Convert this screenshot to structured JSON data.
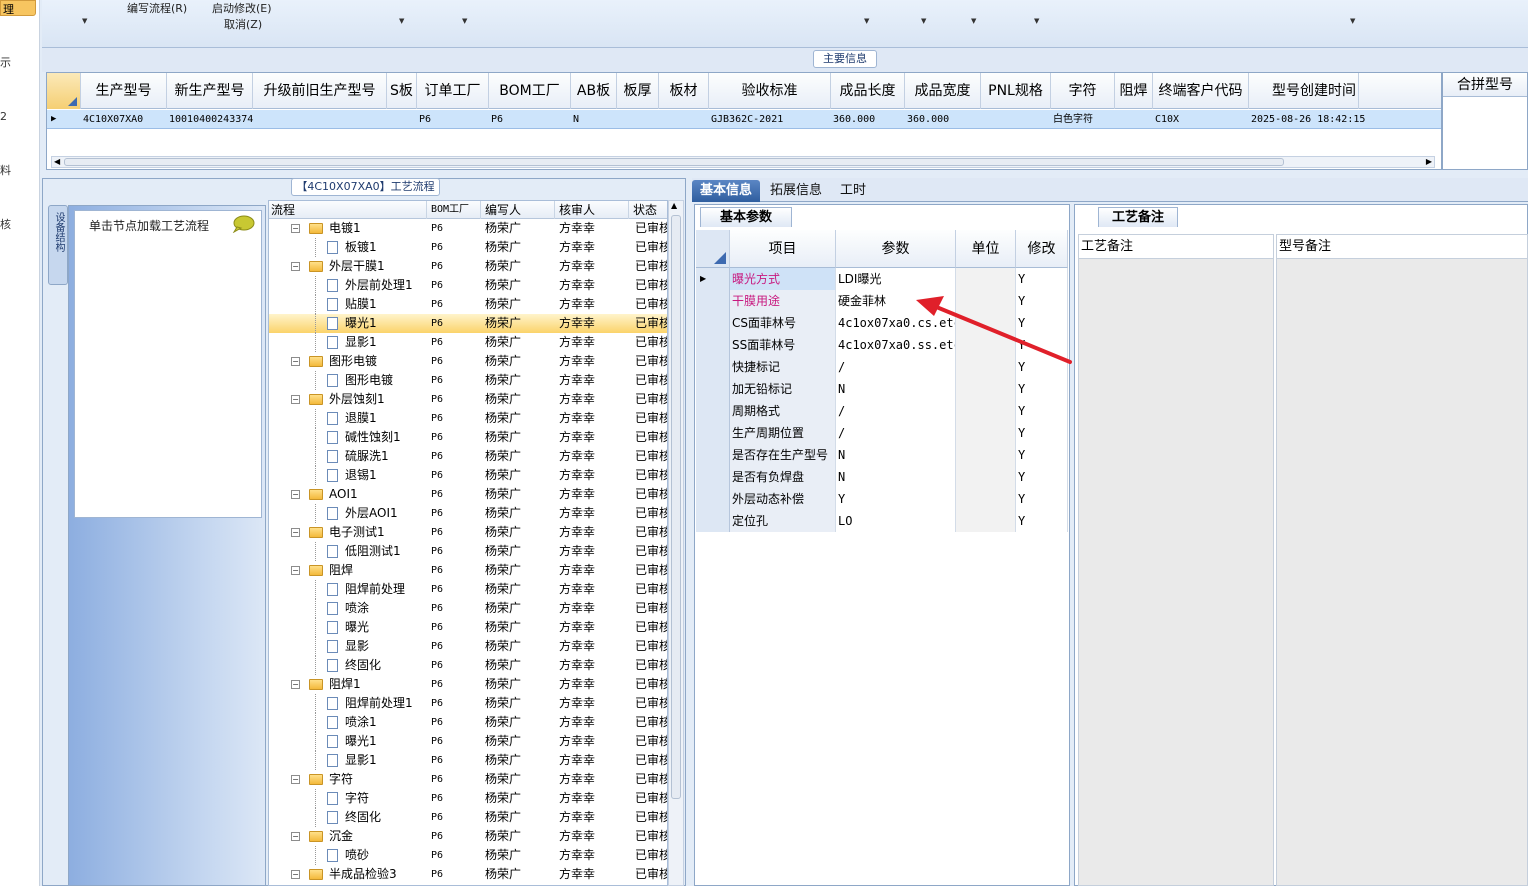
{
  "left_strip": {
    "items": [
      "理",
      "示",
      "2",
      "料",
      "核"
    ]
  },
  "ribbon": {
    "write_flow": "编写流程(R)",
    "start_edit": "启动修改(E)",
    "cancel": "取消(Z)"
  },
  "main_info": {
    "caption": "主要信息",
    "columns": [
      "生产型号",
      "新生产型号",
      "升级前旧生产型号",
      "S板",
      "订单工厂",
      "BOM工厂",
      "AB板",
      "板厚",
      "板材",
      "验收标准",
      "成品长度",
      "成品宽度",
      "PNL规格",
      "字符",
      "阻焊",
      "终端客户代码",
      "型号创建时间"
    ],
    "row": [
      "4C10X07XA0",
      "10010400243374",
      "",
      "",
      "P6",
      "P6",
      "N",
      "",
      "",
      "GJB362C-2021",
      "360.000",
      "360.000",
      "",
      "白色字符",
      "",
      "C10X",
      "2025-08-26 18:42:15"
    ],
    "merge_header": "合拼型号"
  },
  "process": {
    "caption": "【4C10X07XA0】工艺流程",
    "side_tab": "设备结构",
    "load_hint": "单击节点加载工艺流程",
    "columns": [
      "流程",
      "BOM工厂",
      "编写人",
      "核审人",
      "状态"
    ],
    "rows": [
      {
        "name": "电镀1",
        "level": 0,
        "bom": "P6",
        "writer": "杨荣广",
        "reviewer": "方幸幸",
        "status": "已审核"
      },
      {
        "name": "板镀1",
        "level": 1,
        "bom": "P6",
        "writer": "杨荣广",
        "reviewer": "方幸幸",
        "status": "已审核"
      },
      {
        "name": "外层干膜1",
        "level": 0,
        "bom": "P6",
        "writer": "杨荣广",
        "reviewer": "方幸幸",
        "status": "已审核"
      },
      {
        "name": "外层前处理1",
        "level": 1,
        "bom": "P6",
        "writer": "杨荣广",
        "reviewer": "方幸幸",
        "status": "已审核"
      },
      {
        "name": "贴膜1",
        "level": 1,
        "bom": "P6",
        "writer": "杨荣广",
        "reviewer": "方幸幸",
        "status": "已审核"
      },
      {
        "name": "曝光1",
        "level": 1,
        "bom": "P6",
        "writer": "杨荣广",
        "reviewer": "方幸幸",
        "status": "已审核",
        "selected": true
      },
      {
        "name": "显影1",
        "level": 1,
        "bom": "P6",
        "writer": "杨荣广",
        "reviewer": "方幸幸",
        "status": "已审核"
      },
      {
        "name": "图形电镀",
        "level": 0,
        "bom": "P6",
        "writer": "杨荣广",
        "reviewer": "方幸幸",
        "status": "已审核"
      },
      {
        "name": "图形电镀",
        "level": 1,
        "bom": "P6",
        "writer": "杨荣广",
        "reviewer": "方幸幸",
        "status": "已审核"
      },
      {
        "name": "外层蚀刻1",
        "level": 0,
        "bom": "P6",
        "writer": "杨荣广",
        "reviewer": "方幸幸",
        "status": "已审核"
      },
      {
        "name": "退膜1",
        "level": 1,
        "bom": "P6",
        "writer": "杨荣广",
        "reviewer": "方幸幸",
        "status": "已审核"
      },
      {
        "name": "碱性蚀刻1",
        "level": 1,
        "bom": "P6",
        "writer": "杨荣广",
        "reviewer": "方幸幸",
        "status": "已审核"
      },
      {
        "name": "硫脲洗1",
        "level": 1,
        "bom": "P6",
        "writer": "杨荣广",
        "reviewer": "方幸幸",
        "status": "已审核"
      },
      {
        "name": "退锡1",
        "level": 1,
        "bom": "P6",
        "writer": "杨荣广",
        "reviewer": "方幸幸",
        "status": "已审核"
      },
      {
        "name": "AOI1",
        "level": 0,
        "bom": "P6",
        "writer": "杨荣广",
        "reviewer": "方幸幸",
        "status": "已审核"
      },
      {
        "name": "外层AOI1",
        "level": 1,
        "bom": "P6",
        "writer": "杨荣广",
        "reviewer": "方幸幸",
        "status": "已审核"
      },
      {
        "name": "电子测试1",
        "level": 0,
        "bom": "P6",
        "writer": "杨荣广",
        "reviewer": "方幸幸",
        "status": "已审核"
      },
      {
        "name": "低阻测试1",
        "level": 1,
        "bom": "P6",
        "writer": "杨荣广",
        "reviewer": "方幸幸",
        "status": "已审核"
      },
      {
        "name": "阻焊",
        "level": 0,
        "bom": "P6",
        "writer": "杨荣广",
        "reviewer": "方幸幸",
        "status": "已审核"
      },
      {
        "name": "阻焊前处理",
        "level": 1,
        "bom": "P6",
        "writer": "杨荣广",
        "reviewer": "方幸幸",
        "status": "已审核"
      },
      {
        "name": "喷涂",
        "level": 1,
        "bom": "P6",
        "writer": "杨荣广",
        "reviewer": "方幸幸",
        "status": "已审核"
      },
      {
        "name": "曝光",
        "level": 1,
        "bom": "P6",
        "writer": "杨荣广",
        "reviewer": "方幸幸",
        "status": "已审核"
      },
      {
        "name": "显影",
        "level": 1,
        "bom": "P6",
        "writer": "杨荣广",
        "reviewer": "方幸幸",
        "status": "已审核"
      },
      {
        "name": "终固化",
        "level": 1,
        "bom": "P6",
        "writer": "杨荣广",
        "reviewer": "方幸幸",
        "status": "已审核"
      },
      {
        "name": "阻焊1",
        "level": 0,
        "bom": "P6",
        "writer": "杨荣广",
        "reviewer": "方幸幸",
        "status": "已审核"
      },
      {
        "name": "阻焊前处理1",
        "level": 1,
        "bom": "P6",
        "writer": "杨荣广",
        "reviewer": "方幸幸",
        "status": "已审核"
      },
      {
        "name": "喷涂1",
        "level": 1,
        "bom": "P6",
        "writer": "杨荣广",
        "reviewer": "方幸幸",
        "status": "已审核"
      },
      {
        "name": "曝光1",
        "level": 1,
        "bom": "P6",
        "writer": "杨荣广",
        "reviewer": "方幸幸",
        "status": "已审核"
      },
      {
        "name": "显影1",
        "level": 1,
        "bom": "P6",
        "writer": "杨荣广",
        "reviewer": "方幸幸",
        "status": "已审核"
      },
      {
        "name": "字符",
        "level": 0,
        "bom": "P6",
        "writer": "杨荣广",
        "reviewer": "方幸幸",
        "status": "已审核"
      },
      {
        "name": "字符",
        "level": 1,
        "bom": "P6",
        "writer": "杨荣广",
        "reviewer": "方幸幸",
        "status": "已审核"
      },
      {
        "name": "终固化",
        "level": 1,
        "bom": "P6",
        "writer": "杨荣广",
        "reviewer": "方幸幸",
        "status": "已审核"
      },
      {
        "name": "沉金",
        "level": 0,
        "bom": "P6",
        "writer": "杨荣广",
        "reviewer": "方幸幸",
        "status": "已审核"
      },
      {
        "name": "喷砂",
        "level": 1,
        "bom": "P6",
        "writer": "杨荣广",
        "reviewer": "方幸幸",
        "status": "已审核"
      },
      {
        "name": "半成品检验3",
        "level": 0,
        "bom": "P6",
        "writer": "杨荣广",
        "reviewer": "方幸幸",
        "status": "已审核"
      }
    ]
  },
  "right_tabs": [
    "基本信息",
    "拓展信息",
    "工时"
  ],
  "basic_params": {
    "caption": "基本参数",
    "columns": [
      "项目",
      "参数",
      "单位",
      "修改"
    ],
    "rows": [
      {
        "item": "曝光方式",
        "value": "LDI曝光",
        "unit": "",
        "modify": "Y",
        "highlight": true
      },
      {
        "item": "干膜用途",
        "value": "硬金菲林",
        "unit": "",
        "modify": "Y",
        "highlight": true
      },
      {
        "item": "CS面菲林号",
        "value": "4c1ox07xa0.cs.etch",
        "unit": "",
        "modify": "Y"
      },
      {
        "item": "SS面菲林号",
        "value": "4c1ox07xa0.ss.etch",
        "unit": "",
        "modify": "Y"
      },
      {
        "item": "快捷标记",
        "value": "/",
        "unit": "",
        "modify": "Y"
      },
      {
        "item": "加无铅标记",
        "value": "N",
        "unit": "",
        "modify": "Y"
      },
      {
        "item": "周期格式",
        "value": "/",
        "unit": "",
        "modify": "Y"
      },
      {
        "item": "生产周期位置",
        "value": "/",
        "unit": "",
        "modify": "Y"
      },
      {
        "item": "是否存在生产型号",
        "value": "N",
        "unit": "",
        "modify": "Y"
      },
      {
        "item": "是否有负焊盘",
        "value": "N",
        "unit": "",
        "modify": "Y"
      },
      {
        "item": "外层动态补偿",
        "value": "Y",
        "unit": "",
        "modify": "Y"
      },
      {
        "item": "定位孔",
        "value": "LO",
        "unit": "",
        "modify": "Y"
      }
    ]
  },
  "notes": {
    "caption": "工艺备注",
    "col1": "工艺备注",
    "col2": "型号备注"
  },
  "colors": {
    "selected_row": "#fbd36a",
    "highlight_text": "#c8197f",
    "annotation_arrow": "#e0202a",
    "active_tab": "#2f5e9f"
  }
}
